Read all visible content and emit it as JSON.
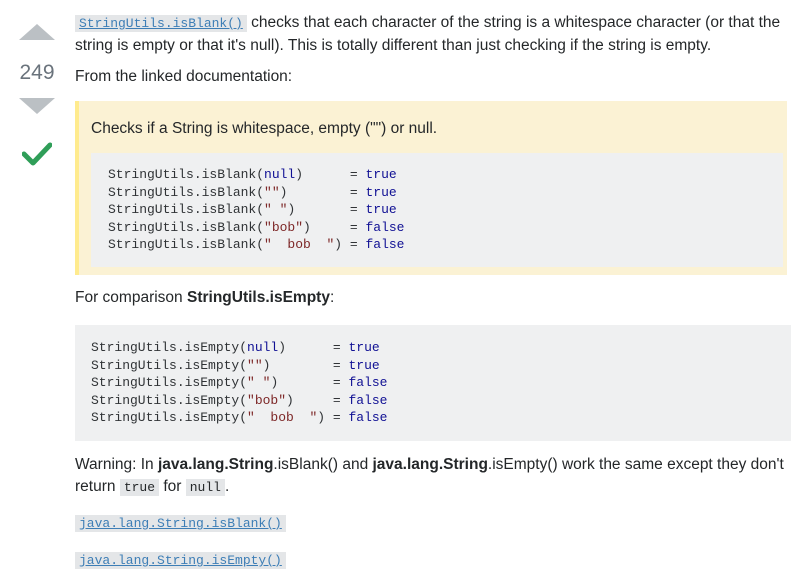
{
  "votes": {
    "count": "249"
  },
  "answer": {
    "intro_code": "StringUtils.isBlank()",
    "intro_text": " checks that each character of the string is a whitespace character (or that the string is empty or that it's null). This is totally different than just checking if the string is empty.",
    "linked_doc": "From the linked documentation:",
    "quote_text": "Checks if a String is whitespace, empty (\"\") or null.",
    "blank_examples": [
      {
        "call": "StringUtils.isBlank(",
        "arg": "null",
        "arg_type": "kw",
        "close": ")      ",
        "result": "true"
      },
      {
        "call": "StringUtils.isBlank(",
        "arg": "\"\"",
        "arg_type": "str",
        "close": ")        ",
        "result": "true"
      },
      {
        "call": "StringUtils.isBlank(",
        "arg": "\" \"",
        "arg_type": "str",
        "close": ")       ",
        "result": "true"
      },
      {
        "call": "StringUtils.isBlank(",
        "arg": "\"bob\"",
        "arg_type": "str",
        "close": ")     ",
        "result": "false"
      },
      {
        "call": "StringUtils.isBlank(",
        "arg": "\"  bob  \"",
        "arg_type": "str",
        "close": ") ",
        "result": "false"
      }
    ],
    "comparison_prefix": "For comparison ",
    "comparison_bold": "StringUtils.isEmpty",
    "comparison_suffix": ":",
    "empty_examples": [
      {
        "call": "StringUtils.isEmpty(",
        "arg": "null",
        "arg_type": "kw",
        "close": ")      ",
        "result": "true"
      },
      {
        "call": "StringUtils.isEmpty(",
        "arg": "\"\"",
        "arg_type": "str",
        "close": ")        ",
        "result": "true"
      },
      {
        "call": "StringUtils.isEmpty(",
        "arg": "\" \"",
        "arg_type": "str",
        "close": ")       ",
        "result": "false"
      },
      {
        "call": "StringUtils.isEmpty(",
        "arg": "\"bob\"",
        "arg_type": "str",
        "close": ")     ",
        "result": "false"
      },
      {
        "call": "StringUtils.isEmpty(",
        "arg": "\"  bob  \"",
        "arg_type": "str",
        "close": ") ",
        "result": "false"
      }
    ],
    "warning": {
      "t1": "Warning: In ",
      "b1": "java.lang.String",
      "t2": ".isBlank() and ",
      "b2": "java.lang.String",
      "t3": ".isEmpty() work the same except they don't return ",
      "c1": "true",
      "t4": " for ",
      "c2": "null",
      "t5": "."
    },
    "link_isblank": "java.lang.String.isBlank()",
    "link_isempty": "java.lang.String.isEmpty()"
  },
  "colors": {
    "accepted": "#2f9e58",
    "link": "#3d7eb6",
    "vote_arrow": "#bbc0c4"
  }
}
